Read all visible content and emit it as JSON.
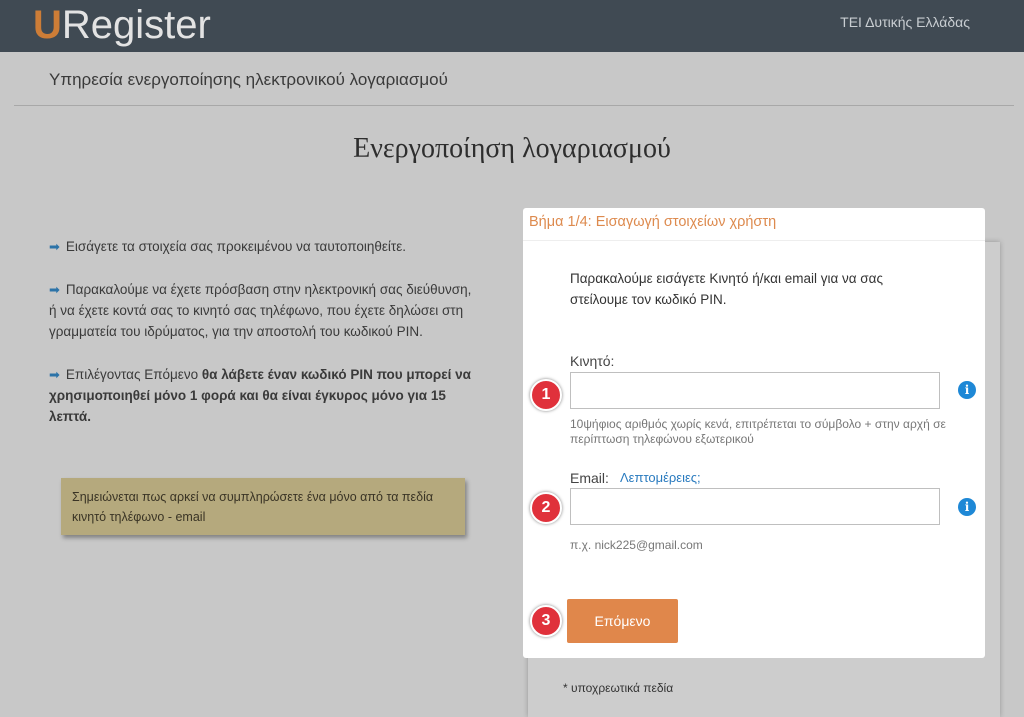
{
  "header": {
    "logo_u": "U",
    "logo_rest": "Register",
    "organization": "ΤΕΙ Δυτικής Ελλάδας"
  },
  "service_title": "Υπηρεσία ενεργοποίησης ηλεκτρονικού λογαριασμού",
  "page_title": "Ενεργοποίηση λογαριασμού",
  "info": {
    "p1": "Εισάγετε τα στοιχεία σας προκειμένου να ταυτοποιηθείτε.",
    "p2": "Παρακαλούμε να έχετε πρόσβαση στην ηλεκτρονική σας διεύθυνση, ή να έχετε κοντά σας το κινητό σας τηλέφωνο, που έχετε δηλώσει στη γραμματεία του ιδρύματος, για την αποστολή του κωδικού PIN.",
    "p3_normal": "Επιλέγοντας Επόμενο ",
    "p3_bold": "θα λάβετε έναν κωδικό PIN που μπορεί να χρησιμοποιηθεί μόνο 1 φορά και θα είναι έγκυρος μόνο για 15 λεπτά.",
    "note": "Σημειώνεται πως αρκεί να συμπληρώσετε ένα μόνο από τα πεδία κινητό τηλέφωνο - email"
  },
  "form": {
    "step_title": "Βήμα 1/4: Εισαγωγή στοιχείων χρήστη",
    "intro": "Παρακαλούμε εισάγετε Κινητό ή/και email για να σας στείλουμε τον κωδικό PIN.",
    "mobile_label": "Κινητό:",
    "mobile_value": "",
    "mobile_hint": "10ψήφιος αριθμός χωρίς κενά, επιτρέπεται το σύμβολο + στην αρχή σε περίπτωση τηλεφώνου εξωτερικού",
    "email_label": "Email:",
    "email_details_link": "Λεπτομέρειες;",
    "email_value": "",
    "email_hint": "π.χ. nick225@gmail.com",
    "next_button": "Επόμενο",
    "required_note": "* υποχρεωτικά πεδία"
  },
  "badges": [
    "1",
    "2",
    "3"
  ],
  "info_icon_glyph": "i",
  "arrow_icon_glyph": "➡",
  "colors": {
    "header_bg": "#404a53",
    "logo_accent": "#cd7d37",
    "step_title": "#dd8a4e",
    "next_button": "#e0874b",
    "badge": "#e0313b",
    "info_icon": "#1e88d6",
    "note_bg": "#b5a97d"
  }
}
